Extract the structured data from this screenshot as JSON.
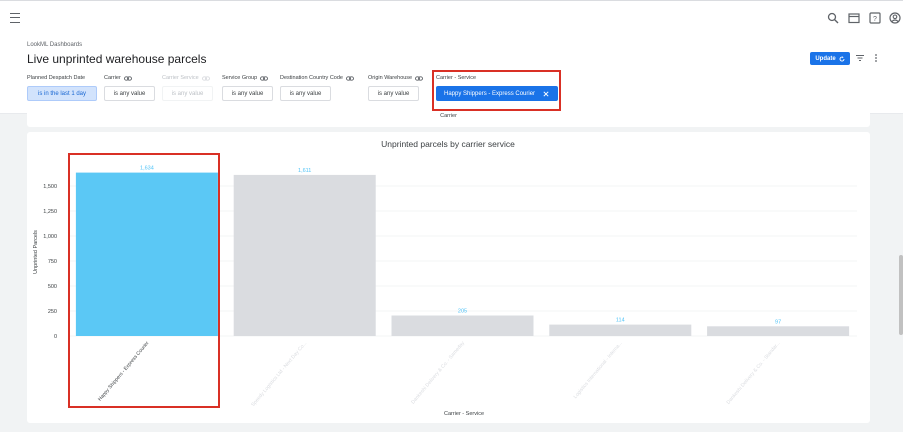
{
  "header": {
    "breadcrumb": "LookML Dashboards",
    "title": "Live unprinted warehouse parcels",
    "update_label": "Update"
  },
  "filters": [
    {
      "label": "Planned Despatch Date",
      "value": "is in the last 1 day",
      "linked": false,
      "state": "active"
    },
    {
      "label": "Carrier",
      "value": "is any value",
      "linked": true,
      "state": "normal"
    },
    {
      "label": "Carrier Service",
      "value": "is any value",
      "linked": true,
      "state": "disabled"
    },
    {
      "label": "Service Group",
      "value": "is any value",
      "linked": true,
      "state": "normal"
    },
    {
      "label": "Destination Country Code",
      "value": "is any value",
      "linked": true,
      "state": "normal"
    },
    {
      "label": "Origin Warehouse",
      "value": "is any value",
      "linked": true,
      "state": "normal"
    },
    {
      "label": "Carrier - Service",
      "value": "Happy Shippers - Express Courier",
      "linked": false,
      "state": "selected"
    }
  ],
  "tile_strip": {
    "label": "Carrier"
  },
  "chart_data": {
    "type": "bar",
    "title": "Unprinted parcels by carrier service",
    "xlabel": "Carrier - Service",
    "ylabel": "Unprinted Parcels",
    "ylim": [
      0,
      1750
    ],
    "yticks": [
      0,
      250,
      500,
      750,
      1000,
      1250,
      1500
    ],
    "ytick_labels": [
      "0",
      "250",
      "500",
      "750",
      "1,000",
      "1,250",
      "1,500"
    ],
    "grid": true,
    "categories": [
      "Happy Shippers - Express Courier",
      "Speedy Logistics Ltd - Next Day Co...",
      "Dankeshi Delivery & Co. - Sameday",
      "Logistics International - Interna...",
      "Dankeshi Delivery & Co. - Standar..."
    ],
    "values": [
      1634,
      1611,
      205,
      114,
      97
    ],
    "value_labels": [
      "1,634",
      "1,611",
      "205",
      "114",
      "97"
    ],
    "highlighted_index": 0,
    "colors": {
      "highlight": "#5bc8f5",
      "muted": "#dadce0",
      "label": "#4fc3f7",
      "axis_text": "#3c4043"
    }
  }
}
